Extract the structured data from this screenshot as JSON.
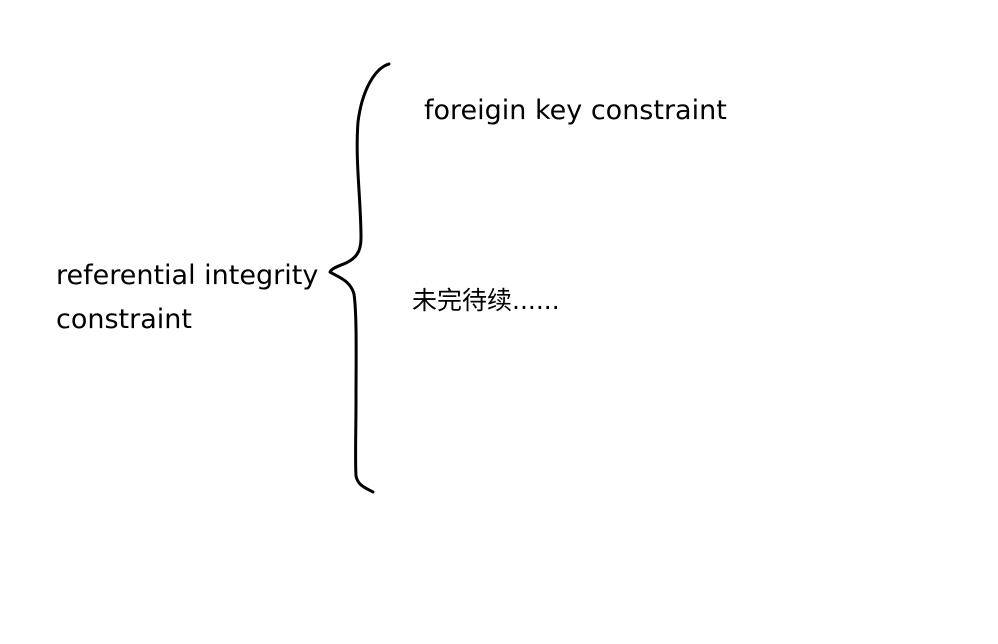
{
  "diagram": {
    "left_label": {
      "line1": "referential integrity",
      "line2": "constraint"
    },
    "right_top_label": "foreigin key constraint",
    "right_bottom_label": "未完待续......",
    "stroke_color": "#000000",
    "background_color": "#ffffff"
  }
}
